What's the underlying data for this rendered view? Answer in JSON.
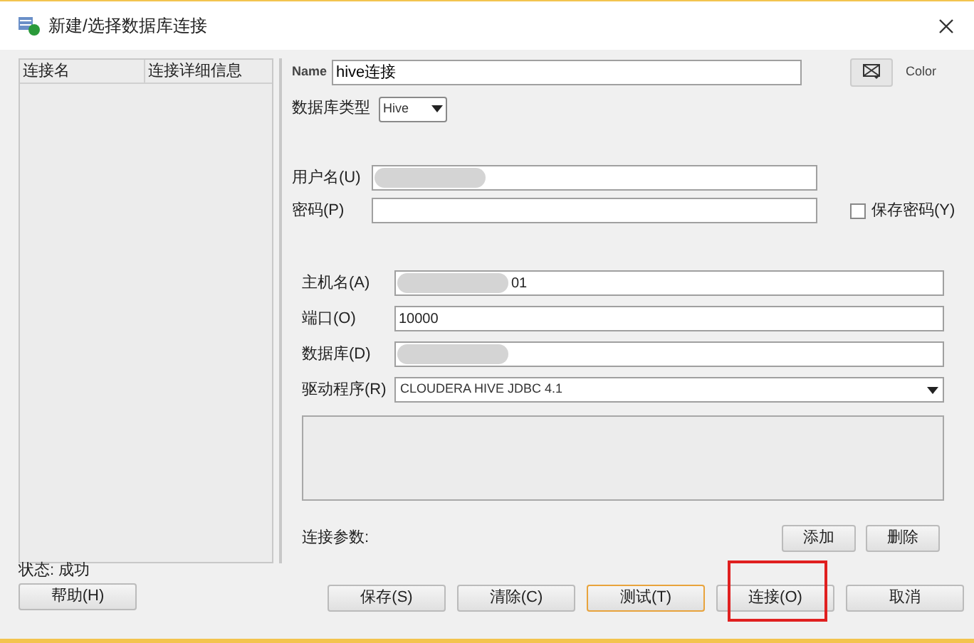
{
  "window": {
    "title": "新建/选择数据库连接"
  },
  "connections_table": {
    "columns": [
      "连接名",
      "连接详细信息"
    ]
  },
  "name_field": {
    "label": "Name",
    "value": "hive连接"
  },
  "color": {
    "label": "Color"
  },
  "db_type": {
    "label": "数据库类型",
    "value": "Hive"
  },
  "fields": [
    {
      "label": "用户名(U)",
      "redacted": true
    },
    {
      "label": "密码(P)",
      "redacted": false
    },
    {
      "label": "主机名(A)",
      "value": "01",
      "redacted": true
    },
    {
      "label": "端口(O)",
      "value": "10000",
      "redacted": false
    },
    {
      "label": "数据库(D)",
      "redacted": true
    }
  ],
  "save_password": {
    "label": "保存密码(Y)",
    "checked": false
  },
  "driver": {
    "label": "驱动程序(R)",
    "value": "CLOUDERA HIVE JDBC 4.1"
  },
  "params": {
    "label": "连接参数:",
    "buttons": [
      "添加",
      "删除"
    ]
  },
  "status": {
    "label": "状态:",
    "value": "成功"
  },
  "help_button": "帮助(H)",
  "buttons": [
    {
      "label": "保存(S)",
      "focused": false,
      "highlighted": false
    },
    {
      "label": "清除(C)",
      "focused": false,
      "highlighted": false
    },
    {
      "label": "测试(T)",
      "focused": true,
      "highlighted": false
    },
    {
      "label": "连接(O)",
      "focused": false,
      "highlighted": true
    },
    {
      "label": "取消",
      "focused": false,
      "highlighted": false
    }
  ]
}
